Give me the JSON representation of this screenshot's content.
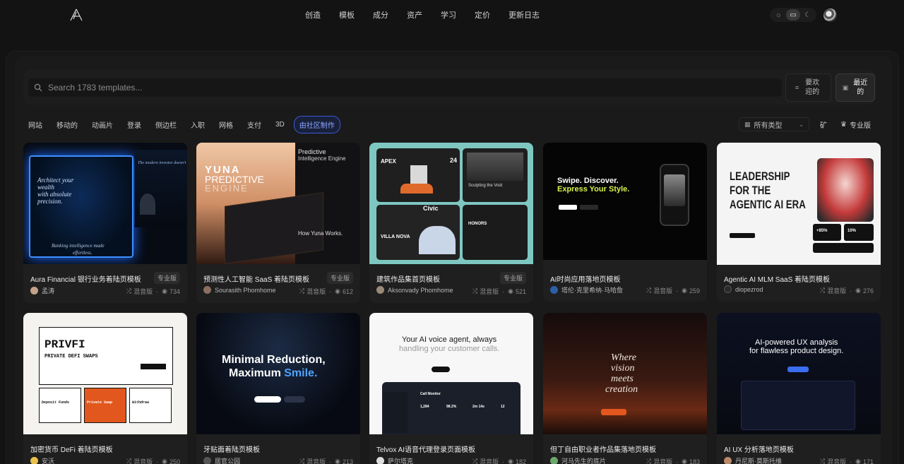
{
  "nav": {
    "links": [
      "创造",
      "模板",
      "成分",
      "资产",
      "学习",
      "定价",
      "更新日志"
    ],
    "theme_icons": [
      "sun-icon",
      "monitor-icon",
      "moon-icon"
    ]
  },
  "search": {
    "placeholder": "Search 1783 templates...",
    "sort_popular": "要欢迎的",
    "sort_recent": "最近的"
  },
  "filters": {
    "chips": [
      "网站",
      "移动的",
      "动画片",
      "登录",
      "侧边栏",
      "入职",
      "网格",
      "支付",
      "3D",
      "由社区制作"
    ],
    "active_chip": "由社区制作",
    "type_select": "所有类型",
    "mine_label": "矿",
    "pro_label": "专业版"
  },
  "cards": [
    {
      "title": "Aura Financial 银行业务着陆页模板",
      "pro": "专业版",
      "author": "孟涛",
      "remix": "混音版",
      "views": "734",
      "thumb": {
        "line1": "Architect your",
        "line2": "wealth",
        "line3": "with absolute",
        "line4": "precision.",
        "side": "The modern investor doesn't",
        "foot": "Banking intelligence made",
        "foot2": "effortless."
      }
    },
    {
      "title": "预测性人工智能 SaaS 着陆页模板",
      "pro": "专业版",
      "author": "Sourasith Phomhome",
      "remix": "混音版",
      "views": "612",
      "thumb": {
        "a": "YUNA",
        "b": "PREDICTIVE",
        "c": "ENGINE",
        "d": "Predictive",
        "e": "Intelligence Engine",
        "f": "How Yuna Works."
      }
    },
    {
      "title": "建筑作品集首页模板",
      "pro": "专业版",
      "author": "Aksonvady Phomhome",
      "remix": "混音版",
      "views": "521",
      "thumb": {
        "a": "APEX",
        "b": "24",
        "c": "Sculpting the Void",
        "d": "Civic",
        "e": "VILLA NOVA",
        "f": "HONORS"
      }
    },
    {
      "title": "AI时尚应用落地页模板",
      "pro": "",
      "author": "塔伦·克里希纳·马哈詹",
      "remix": "混音版",
      "views": "259",
      "thumb": {
        "a": "Swipe. Discover.",
        "b": "Express Your Style."
      }
    },
    {
      "title": "Agentic AI MLM SaaS 着陆页模板",
      "pro": "",
      "author": "diopezrod",
      "remix": "混音版",
      "views": "276",
      "thumb": {
        "a": "LEADERSHIP",
        "b": "FOR THE",
        "c": "AGENTIC AI ERA",
        "d": "+85%",
        "e": "10%"
      }
    },
    {
      "title": "加密货币 DeFi 着陆页模板",
      "pro": "",
      "author": "安沃",
      "remix": "混音版",
      "views": "250",
      "thumb": {
        "a": "PRIVFI",
        "b": "PRIVATE DEFI SWAPS",
        "c": "Deposit Funds",
        "d": "Private Swap",
        "e": "Withdraw"
      }
    },
    {
      "title": "牙贴面着陆页模板",
      "pro": "",
      "author": "居官公园",
      "remix": "混音版",
      "views": "213",
      "thumb": {
        "a": "Minimal Reduction,",
        "b": "Maximum ",
        "c": "Smile."
      }
    },
    {
      "title": "Telvox AI语音代理登录页面模板",
      "pro": "",
      "author": "萨尔塔克",
      "remix": "混音版",
      "views": "182",
      "thumb": {
        "a": "Your AI voice agent, always",
        "b": "handling your customer calls.",
        "c": "Call Monitor",
        "d": "1,284",
        "e": "98.2%",
        "f": "2m 14s",
        "g": "12"
      }
    },
    {
      "title": "但丁自由职业者作品集落地页模板",
      "pro": "",
      "author": "河马先生的底片",
      "remix": "混音版",
      "views": "183",
      "thumb": {
        "a": "Where",
        "b": "vision",
        "c": "meets",
        "d": "creation"
      }
    },
    {
      "title": "AI UX 分析落地页模板",
      "pro": "",
      "author": "丹尼斯·莫斯托维",
      "remix": "混音版",
      "views": "171",
      "thumb": {
        "a": "AI-powered UX analysis",
        "b": "for flawless product design."
      }
    }
  ],
  "colors": {
    "accent": "#3b5ad8",
    "bg": "#131313",
    "card": "#1f1f1f"
  }
}
